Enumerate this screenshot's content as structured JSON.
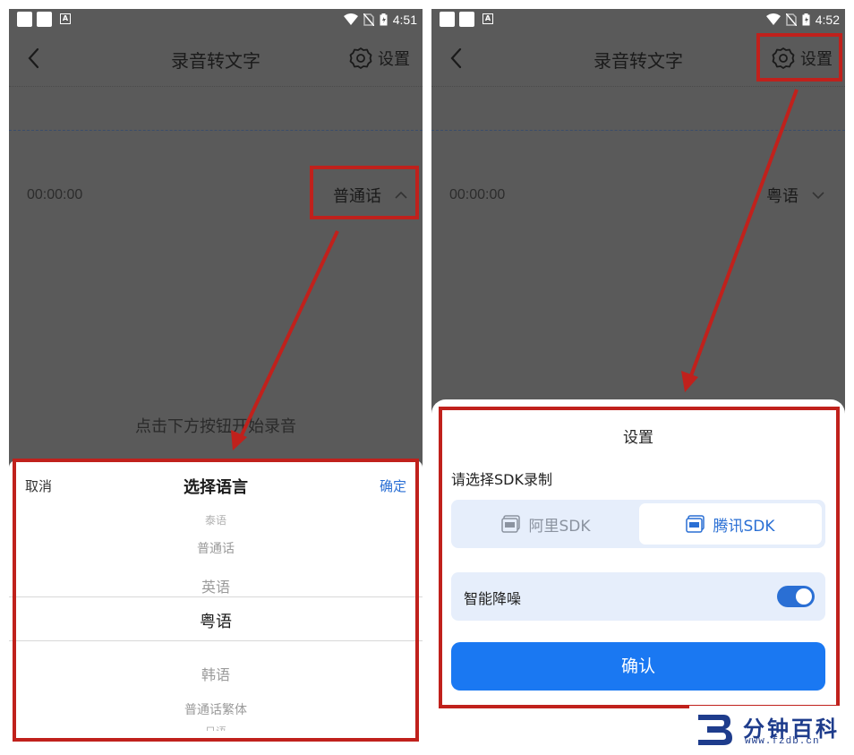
{
  "left": {
    "status_time": "4:51",
    "title": "录音转文字",
    "settings_label": "设置",
    "timer": "00:00:00",
    "language": "普通话",
    "hint": "点击下方按钮开始录音",
    "sheet": {
      "cancel": "取消",
      "title": "选择语言",
      "confirm": "确定",
      "options": [
        "泰语",
        "普通话",
        "英语",
        "粤语",
        "韩语",
        "普通话繁体",
        "日语"
      ],
      "selected": "粤语"
    }
  },
  "right": {
    "status_time": "4:52",
    "title": "录音转文字",
    "settings_label": "设置",
    "timer": "00:00:00",
    "language": "粤语",
    "sheet": {
      "title": "设置",
      "sdk_label": "请选择SDK录制",
      "sdk_options": [
        "阿里SDK",
        "腾讯SDK"
      ],
      "sdk_selected": "腾讯SDK",
      "denoise_label": "智能降噪",
      "denoise_on": true,
      "confirm": "确认"
    }
  },
  "watermark": {
    "name": "分钟百科",
    "url": "www.fzdb.cn"
  },
  "colors": {
    "accent": "#1a78f2",
    "highlight": "#c0211c",
    "overlay": "#5a5a5a"
  }
}
